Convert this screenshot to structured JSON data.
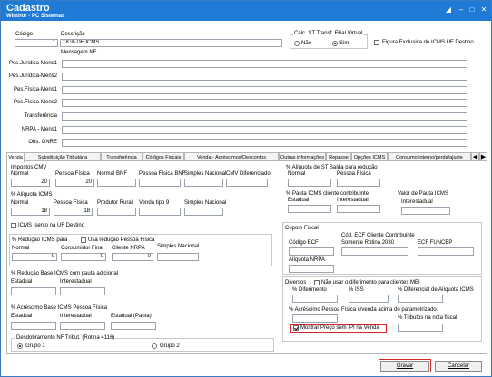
{
  "window": {
    "title": "Cadastro",
    "subtitle": "Winthor - PC Sistemas",
    "pin_icon": "pin-icon",
    "minimize_icon": "minimize-icon",
    "maximize_icon": "maximize-icon",
    "close_icon": "close-icon"
  },
  "header": {
    "codigo_label": "Código",
    "codigo_value": "1",
    "descricao_label": "Descrição",
    "descricao_value": "18 % DE ICMS",
    "mensagem_nf_label": "Mensagem NF",
    "calc_st_label": "Calc. ST Transf. Filial Virtual",
    "nao_label": "Não",
    "sim_label": "Sim",
    "fig_exclusiva_label": "Figura Exclusiva de ICMS UF Destino"
  },
  "mensagens": [
    {
      "label": "Pes.Jurídica-Mens1",
      "value": ""
    },
    {
      "label": "Pes.Jurídica-Mens2",
      "value": ""
    },
    {
      "label": "Pes.Física-Mens1",
      "value": ""
    },
    {
      "label": "Pes.Física-Mens2",
      "value": ""
    },
    {
      "label": "Transferência",
      "value": ""
    },
    {
      "label": "NRPA - Mens1",
      "value": ""
    },
    {
      "label": "Obs. GNRE",
      "value": ""
    }
  ],
  "tabs": [
    {
      "label": "Venda"
    },
    {
      "label": "Substituição Tributária"
    },
    {
      "label": "Transferência"
    },
    {
      "label": "Códigos Fiscais"
    },
    {
      "label": "Venda - Acréscimos/Descontos"
    },
    {
      "label": "Outras informações"
    },
    {
      "label": "Repasse"
    },
    {
      "label": "Opções ICMS"
    },
    {
      "label": "Consumo interno/perda/ajuste"
    }
  ],
  "tab_scroll": {
    "left_icon": "chevron-left-icon",
    "right_icon": "chevron-right-icon"
  },
  "venda": {
    "impostos_cmv_label": "Impostos CMV",
    "cmv": {
      "normal_label": "Normal",
      "normal_value": "20",
      "pf_label": "Pessoa Física",
      "pf_value": "20",
      "normal_bnf_label": "Normal BNF",
      "pf_bnf_label": "Pessoa Física BNF",
      "simples_label": "Simples Nacional",
      "cmv_dif_label": "CMV Diferenciado"
    },
    "aliq_icms_label": "% Alíquota ICMS",
    "aliq": {
      "normal_label": "Normal",
      "normal_value": "18",
      "pf_label": "Pessoa Física",
      "pf_value": "18",
      "prod_rural_label": "Produtor Rural",
      "venda_tipo9_label": "Venda tipo 9",
      "simples_label": "Simples Nacional"
    },
    "icms_isento_label": "ICMS Isento na UF Destino",
    "red_icms_label": "% Redução ICMS para",
    "usa_red_pf_label": "Usa redução Pessoa Física",
    "red": {
      "normal_label": "Normal",
      "normal_value": "0",
      "consumidor_label": "Consumidor Final",
      "consumidor_value": "0",
      "nrpa_label": "Cliente NRPA",
      "nrpa_value": "0",
      "simples_label": "Simples Nacional"
    },
    "red_base_pauta_label": "% Redução Base ICMS com pauta adicional",
    "red_base": {
      "estadual_label": "Estadual",
      "interestadual_label": "Interestadual"
    },
    "acresc_base_pf_label": "% Acréscimo Base ICMS Pessoa Física",
    "acresc_base": {
      "estadual_label": "Estadual",
      "interestadual_label": "Interestadual",
      "estadual_pauta_label": "Estadual (Pauta)"
    },
    "desdobramento_label": "Desdobramento NF Tribut. (Rotina 4116)",
    "grupo1_label": "Grupo 1",
    "grupo2_label": "Grupo 2",
    "st_saida_label": "% Alíquota de ST Saída para redução",
    "st_saida": {
      "normal_label": "Normal",
      "pf_label": "Pessoa Física"
    },
    "pauta_cliente_label": "% Pauta ICMS cliente contribuinte",
    "pauta_cliente": {
      "estadual_label": "Estadual",
      "interestadual_label": "Interestadual"
    },
    "valor_pauta_label": "Valor de Pauta ICMS",
    "valor_pauta": {
      "interestadual_label": "Interestadual"
    },
    "cupom_fiscal_label": "Cupom Fiscal",
    "cupom": {
      "cod_ecf_label": "Código ECF",
      "cod_ecf_cli_label": "Cód. ECF Cliente Contribuinte",
      "rotina_label": "Somente Rotina 2030",
      "funcep_label": "ECF FUNCEP",
      "aliq_nrpa_label": "Alíquota NRPA"
    },
    "diversos_label": "Diversos",
    "nao_usar_dif_label": "Não usar o diferimento para clientes MEI",
    "diversos": {
      "diferimento_label": "% Diferimento",
      "iss_label": "% ISS",
      "dif_aliq_label": "% Diferencial de Alíquota ICMS"
    },
    "acresc_pf_label": "% Acréscimo Pessoa Física c/venda acima do parametrizado.",
    "mostrar_preco_label": "Mostrar Preço sem IPI na Venda",
    "trib_nota_label": "% Tributos na nota fiscal"
  },
  "buttons": {
    "gravar": "Gravar",
    "cancelar": "Cancelar"
  },
  "colors": {
    "titlebar": "#1f7bd6",
    "highlight": "#d9252a"
  }
}
